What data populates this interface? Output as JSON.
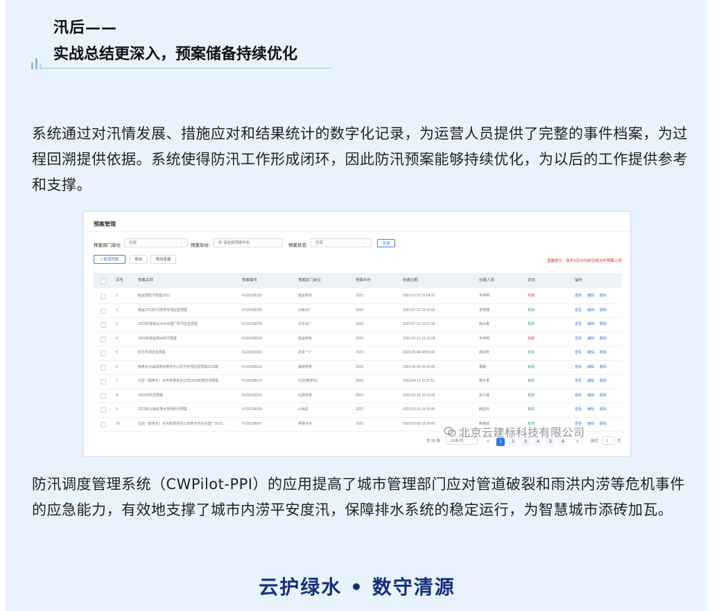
{
  "section": {
    "title_line1": "汛后——",
    "title_line2": "实战总结更深入，预案储备持续优化"
  },
  "paragraph1": "系统通过对汛情发展、措施应对和结果统计的数字化记录，为运营人员提供了完整的事件档案，为过程回溯提供依据。系统使得防汛工作形成闭环，因此防汛预案能够持续优化，为以后的工作提供参考和支撑。",
  "screenshot": {
    "title": "预案管理",
    "filters": {
      "dept_label": "预案部门单位:",
      "dept_value": "全部",
      "year_label": "预案年份:",
      "year_placeholder": "请选择预案年份",
      "status_label": "预案状态:",
      "status_value": "全部",
      "query_button": "查询"
    },
    "actions": {
      "add": "+ 新增预案",
      "export": "导出",
      "export_all": "导出全部"
    },
    "notice": "温馨提示：每年3月30日前完成当年预案上传",
    "columns": [
      "序号",
      "预案名称",
      "预案编号",
      "预案部门单位",
      "预案年份",
      "创建日期",
      "创建人员",
      "状态",
      "操作"
    ],
    "rows": [
      {
        "no": "1",
        "name": "衡运预防汛预案2023",
        "code": "FX20230032",
        "dept": "衡运排管",
        "year": "2023",
        "date": "2023-07-25 15:04:33",
        "user": "韦伟明",
        "status": "失效",
        "status_color": "red"
      },
      {
        "no": "2",
        "name": "衡运2023防汛排涝专项应急预案",
        "code": "FX20230030",
        "dept": "云新水厂",
        "year": "2023",
        "date": "2023-07-21 22:16:52",
        "user": "李涛博",
        "status": "有效",
        "status_color": "green"
      },
      {
        "no": "3",
        "name": "2023年度衡云污水处理厂防汛应急预案",
        "code": "FX20230028",
        "dept": "丹东水厂",
        "year": "2023",
        "date": "2023-07-21 10:17:25",
        "user": "韩大勇",
        "status": "有效",
        "status_color": "green"
      },
      {
        "no": "4",
        "name": "2023年衡运排水防汛预案",
        "code": "FX20230024",
        "dept": "衡运排管",
        "year": "2023",
        "date": "2023-07-21 15:13:04",
        "user": "韦伟明",
        "status": "失效",
        "status_color": "red"
      },
      {
        "no": "5",
        "name": "防汛专项应急预案",
        "code": "FX20230020",
        "dept": "丹东一厂",
        "year": "2023",
        "date": "2023-05-08 08:50:38",
        "user": "成向男",
        "status": "有效",
        "status_color": "green"
      },
      {
        "no": "6",
        "name": "衡意东州海滨排水服务中心防汛专项应急预案2023版",
        "code": "FX20230016",
        "dept": "海滨排管",
        "year": "2023",
        "date": "2023-05-06 09:40:25",
        "user": "曹朗",
        "status": "有效",
        "status_color": "green"
      },
      {
        "no": "7",
        "name": "北控（衡意东）水务有限责任公司2023年度防汛预案",
        "code": "FX20230014",
        "dept": "北控(衡意东)",
        "year": "2023",
        "date": "2023-04-13 11:37:52",
        "user": "韩大勇",
        "status": "有效",
        "status_color": "green"
      },
      {
        "no": "8",
        "name": "2023年防汛预案",
        "code": "FX20230010",
        "dept": "北部排管",
        "year": "2023",
        "date": "2023-03-16 10:19:28",
        "user": "高子建",
        "status": "有效",
        "status_color": "green"
      },
      {
        "no": "9",
        "name": "2023年山海关排水管网防汛预案",
        "code": "FX20230009",
        "dept": "山海关",
        "year": "2023",
        "date": "2023-03-15 15:26:45",
        "user": "韩显侦",
        "status": "有效",
        "status_color": "green"
      },
      {
        "no": "10",
        "name": "北控（衡意东）水务有限责任公司排污污水处理厂2023...",
        "code": "FX20230007",
        "dept": "排港污水",
        "year": "2023",
        "date": "2023-03-09 12:30:42",
        "user": "韩海波",
        "status": "有效",
        "status_color": "green"
      }
    ],
    "ops": [
      "查看",
      "编辑",
      "删除"
    ],
    "pagination": {
      "total": "共 55 条",
      "page_size": "10条/页",
      "prev": "<",
      "pages": [
        "1",
        "2",
        "3",
        "4",
        "5",
        "6"
      ],
      "active_page": "1",
      "next": ">",
      "goto_label": "前往",
      "goto_value": "1",
      "page_suffix": "页"
    }
  },
  "watermark": "北京云建标科技有限公司",
  "paragraph2": "防汛调度管理系统（CWPilot-PPI）的应用提高了城市管理部门应对管道破裂和雨洪内涝等危机事件的应急能力，有效地支撑了城市内涝平安度汛，保障排水系统的稳定运行，为智慧城市添砖加瓦。",
  "slogan": "云护绿水 • 数守清源",
  "colors": {
    "panel_bg": "#e9f3fd",
    "slogan": "#14307a",
    "accent_blue": "#2f76e8",
    "status_red": "#e0322f",
    "status_green": "#3aa55a"
  }
}
